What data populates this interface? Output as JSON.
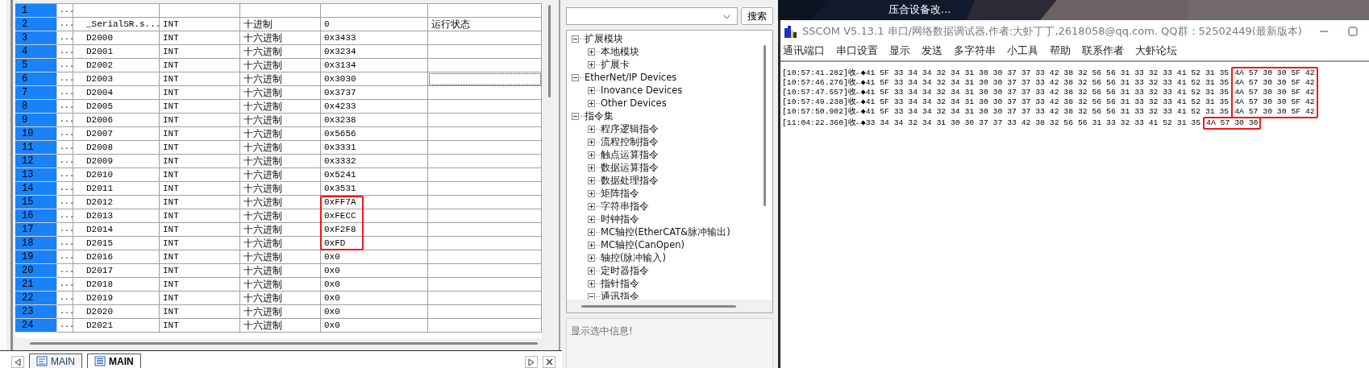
{
  "plc_table": {
    "rows": [
      {
        "number": "1",
        "dots": "...",
        "focused": false,
        "boxed": false
      },
      {
        "number": "2",
        "dots": "...",
        "name": "_SerialSR.s...",
        "type": "INT",
        "format": "十进制",
        "value": "0",
        "comment": "运行状态",
        "focused": false,
        "boxed": false
      },
      {
        "number": "3",
        "dots": "...",
        "name": "D2000",
        "type": "INT",
        "format": "十六进制",
        "value": "0x3433",
        "focused": false,
        "boxed": false
      },
      {
        "number": "4",
        "dots": "...",
        "name": "D2001",
        "type": "INT",
        "format": "十六进制",
        "value": "0x3234",
        "focused": false,
        "boxed": false
      },
      {
        "number": "5",
        "dots": "...",
        "name": "D2002",
        "type": "INT",
        "format": "十六进制",
        "value": "0x3134",
        "focused": false,
        "boxed": false
      },
      {
        "number": "6",
        "dots": "...",
        "name": "D2003",
        "type": "INT",
        "format": "十六进制",
        "value": "0x3030",
        "focused": true,
        "boxed": false
      },
      {
        "number": "7",
        "dots": "...",
        "name": "D2004",
        "type": "INT",
        "format": "十六进制",
        "value": "0x3737",
        "focused": false,
        "boxed": false
      },
      {
        "number": "8",
        "dots": "...",
        "name": "D2005",
        "type": "INT",
        "format": "十六进制",
        "value": "0x4233",
        "focused": false,
        "boxed": false
      },
      {
        "number": "9",
        "dots": "...",
        "name": "D2006",
        "type": "INT",
        "format": "十六进制",
        "value": "0x3238",
        "focused": false,
        "boxed": false
      },
      {
        "number": "10",
        "dots": "...",
        "name": "D2007",
        "type": "INT",
        "format": "十六进制",
        "value": "0x5656",
        "focused": false,
        "boxed": false
      },
      {
        "number": "11",
        "dots": "...",
        "name": "D2008",
        "type": "INT",
        "format": "十六进制",
        "value": "0x3331",
        "focused": false,
        "boxed": false
      },
      {
        "number": "12",
        "dots": "...",
        "name": "D2009",
        "type": "INT",
        "format": "十六进制",
        "value": "0x3332",
        "focused": false,
        "boxed": false
      },
      {
        "number": "13",
        "dots": "...",
        "name": "D2010",
        "type": "INT",
        "format": "十六进制",
        "value": "0x5241",
        "focused": false,
        "boxed": false
      },
      {
        "number": "14",
        "dots": "...",
        "name": "D2011",
        "type": "INT",
        "format": "十六进制",
        "value": "0x3531",
        "focused": false,
        "boxed": false
      },
      {
        "number": "15",
        "dots": "...",
        "name": "D2012",
        "type": "INT",
        "format": "十六进制",
        "value": "0xFF7A",
        "focused": false,
        "boxed": true
      },
      {
        "number": "16",
        "dots": "...",
        "name": "D2013",
        "type": "INT",
        "format": "十六进制",
        "value": "0xFECC",
        "focused": false,
        "boxed": true
      },
      {
        "number": "17",
        "dots": "...",
        "name": "D2014",
        "type": "INT",
        "format": "十六进制",
        "value": "0xF2F8",
        "focused": false,
        "boxed": true
      },
      {
        "number": "18",
        "dots": "...",
        "name": "D2015",
        "type": "INT",
        "format": "十六进制",
        "value": "0xFD",
        "focused": false,
        "boxed": true
      },
      {
        "number": "19",
        "dots": "...",
        "name": "D2016",
        "type": "INT",
        "format": "十六进制",
        "value": "0x0",
        "focused": false,
        "boxed": false
      },
      {
        "number": "20",
        "dots": "...",
        "name": "D2017",
        "type": "INT",
        "format": "十六进制",
        "value": "0x0",
        "focused": false,
        "boxed": false
      },
      {
        "number": "21",
        "dots": "...",
        "name": "D2018",
        "type": "INT",
        "format": "十六进制",
        "value": "0x0",
        "focused": false,
        "boxed": false
      },
      {
        "number": "22",
        "dots": "...",
        "name": "D2019",
        "type": "INT",
        "format": "十六进制",
        "value": "0x0",
        "focused": false,
        "boxed": false
      },
      {
        "number": "23",
        "dots": "...",
        "name": "D2020",
        "type": "INT",
        "format": "十六进制",
        "value": "0x0",
        "focused": false,
        "boxed": false
      },
      {
        "number": "24",
        "dots": "...",
        "name": "D2021",
        "type": "INT",
        "format": "十六进制",
        "value": "0x0",
        "focused": false,
        "boxed": false
      }
    ]
  },
  "editor_tabs": [
    {
      "label": "MAIN",
      "kind": "program",
      "selected": false
    },
    {
      "label": "MAIN",
      "kind": "table",
      "selected": true
    }
  ],
  "instruction_panel": {
    "search_button": "搜索",
    "tree": [
      {
        "label": "扩展模块",
        "expanded": true,
        "children": [
          {
            "label": "本地模块",
            "expanded": false
          },
          {
            "label": "扩展卡",
            "expanded": false
          }
        ]
      },
      {
        "label": "EtherNet/IP Devices",
        "expanded": true,
        "children": [
          {
            "label": "Inovance Devices",
            "expanded": false
          },
          {
            "label": "Other Devices",
            "expanded": false
          }
        ]
      },
      {
        "label": "指令集",
        "expanded": true,
        "children": [
          {
            "label": "程序逻辑指令",
            "expanded": false
          },
          {
            "label": "流程控制指令",
            "expanded": false
          },
          {
            "label": "触点运算指令",
            "expanded": false
          },
          {
            "label": "数据运算指令",
            "expanded": false
          },
          {
            "label": "数据处理指令",
            "expanded": false
          },
          {
            "label": "矩阵指令",
            "expanded": false
          },
          {
            "label": "字符串指令",
            "expanded": false
          },
          {
            "label": "时钟指令",
            "expanded": false
          },
          {
            "label": "MC轴控(EtherCAT&脉冲输出)",
            "expanded": false
          },
          {
            "label": "MC轴控(CanOpen)",
            "expanded": false
          },
          {
            "label": "轴控(脉冲输入)",
            "expanded": false
          },
          {
            "label": "定时器指令",
            "expanded": false
          },
          {
            "label": "指针指令",
            "expanded": false
          },
          {
            "label": "通讯指令",
            "expanded": true
          }
        ]
      }
    ],
    "info": "显示选中信息!"
  },
  "desktop": {
    "caption": "压合设备改..."
  },
  "sscom": {
    "title": "SSCOM V5.13.1 串口/网络数据调试器,作者:大虾丁丁,2618058@qq.com. QQ群：52502449(最新版本)",
    "menu": [
      "通讯端口",
      "串口设置",
      "显示",
      "发送",
      "多字符串",
      "小工具",
      "帮助",
      "联系作者",
      "大虾论坛"
    ],
    "log_groups": [
      {
        "lines": [
          {
            "text": "[10:57:41.282]收←◆41 5F 33 34 34 32 34 31 30 30 37 37 33 42 38 32 56 56 31 33 32 33 41 52 31 35",
            "tail": "4A 57 30 30 5F 42"
          },
          {
            "text": "[10:57:46.276]收←◆41 5F 33 34 34 32 34 31 30 30 37 37 33 42 38 32 56 56 31 33 32 33 41 52 31 35",
            "tail": "4A 57 30 30 5F 42"
          },
          {
            "text": "[10:57:47.557]收←◆41 5F 33 34 34 32 34 31 30 30 37 37 33 42 38 32 56 56 31 33 32 33 41 52 31 35",
            "tail": "4A 57 30 30 5F 42"
          },
          {
            "text": "[10:57:49.238]收←◆41 5F 33 34 34 32 34 31 30 30 37 37 33 42 38 32 56 56 31 33 32 33 41 52 31 35",
            "tail": "4A 57 30 30 5F 42"
          },
          {
            "text": "[10:57:50.902]收←◆41 5F 33 34 34 32 34 31 30 30 37 37 33 42 38 32 56 56 31 33 32 33 41 52 31 35",
            "tail": "4A 57 30 30 5F 42"
          }
        ]
      },
      {
        "lines": [
          {
            "text": "[11:04:22.360]收←◆33 34 34 32 34 31 30 30 37 37 33 42 38 32 56 56 31 33 32 33 41 52 31 35",
            "tail": "4A 57 30 30"
          }
        ]
      }
    ]
  }
}
